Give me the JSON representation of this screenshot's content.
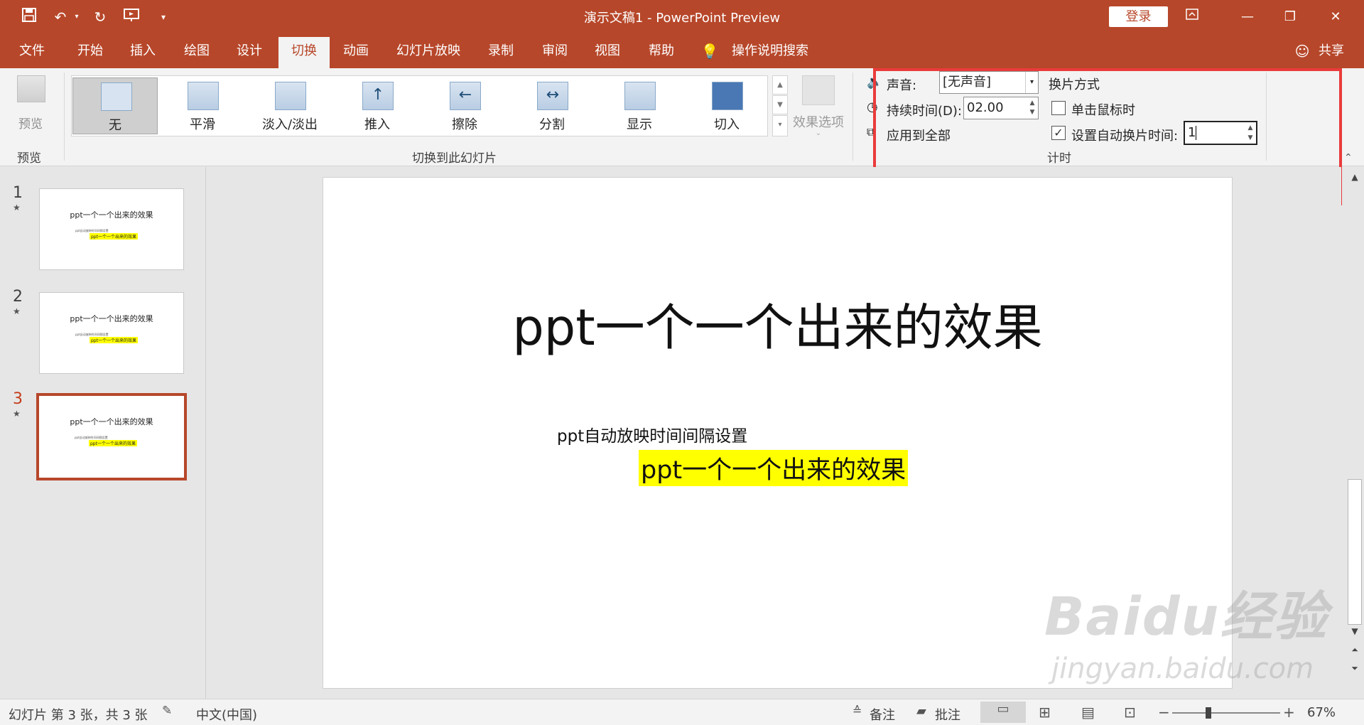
{
  "window": {
    "title": "演示文稿1 - PowerPoint Preview",
    "login_label": "登录",
    "colors": {
      "brand": "#b7472a",
      "highlight": "#ffff00",
      "annotation": "#ea3b3b"
    }
  },
  "tabs": [
    {
      "label": "文件"
    },
    {
      "label": "开始"
    },
    {
      "label": "插入"
    },
    {
      "label": "绘图"
    },
    {
      "label": "设计"
    },
    {
      "label": "切换",
      "active": true
    },
    {
      "label": "动画"
    },
    {
      "label": "幻灯片放映"
    },
    {
      "label": "录制"
    },
    {
      "label": "审阅"
    },
    {
      "label": "视图"
    },
    {
      "label": "帮助"
    }
  ],
  "tell_me": "操作说明搜索",
  "share_label": "共享",
  "ribbon": {
    "preview": {
      "button_label": "预览",
      "group_label": "预览"
    },
    "transitions": {
      "items": [
        {
          "label": "无",
          "selected": true
        },
        {
          "label": "平滑"
        },
        {
          "label": "淡入/淡出"
        },
        {
          "label": "推入"
        },
        {
          "label": "擦除"
        },
        {
          "label": "分割"
        },
        {
          "label": "显示"
        },
        {
          "label": "切入"
        }
      ],
      "effect_options_label": "效果选项",
      "group_label": "切换到此幻灯片"
    },
    "timing": {
      "sound_label": "声音:",
      "sound_value": "[无声音]",
      "duration_label": "持续时间(D):",
      "duration_value": "02.00",
      "apply_all_label": "应用到全部",
      "advance_header": "换片方式",
      "on_click_label": "单击鼠标时",
      "on_click_checked": false,
      "after_label": "设置自动换片时间:",
      "after_checked": true,
      "after_value": "1",
      "group_label": "计时"
    }
  },
  "thumbnails": [
    {
      "number": "1",
      "title": "ppt一个一个出来的效果",
      "subtitle": "ppt自动放映时间间隔设置",
      "highlight": "ppt一个一个出来的效果"
    },
    {
      "number": "2",
      "title": "ppt一个一个出来的效果",
      "subtitle": "ppt自动放映时间间隔设置",
      "highlight": "ppt一个一个出来的效果"
    },
    {
      "number": "3",
      "title": "ppt一个一个出来的效果",
      "subtitle": "ppt自动放映时间间隔设置",
      "highlight": "ppt一个一个出来的效果",
      "current": true
    }
  ],
  "slide": {
    "title": "ppt一个一个出来的效果",
    "subtitle": "ppt自动放映时间间隔设置",
    "highlight_text": "ppt一个一个出来的效果"
  },
  "status": {
    "slide_info": "幻灯片 第 3 张，共 3 张",
    "language": "中文(中国)",
    "notes_label": "备注",
    "comments_label": "批注",
    "zoom": "67%",
    "zoom_fraction": 0.67
  },
  "watermark": {
    "logo_text": "Baidu经验",
    "url_text": "jingyan.baidu.com"
  }
}
